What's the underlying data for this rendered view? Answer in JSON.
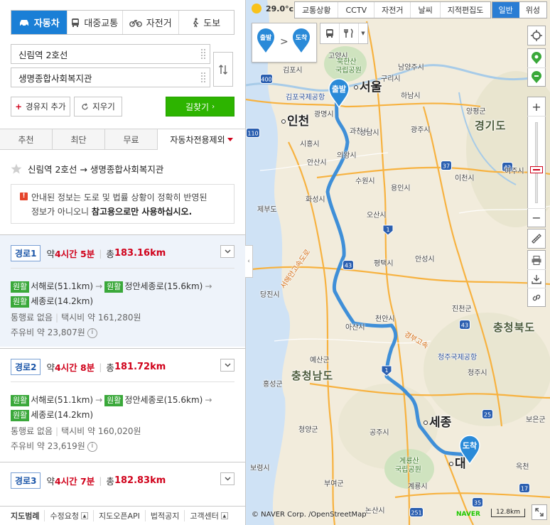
{
  "modes": [
    {
      "label": "자동차",
      "active": true
    },
    {
      "label": "대중교통",
      "active": false
    },
    {
      "label": "자전거",
      "active": false
    },
    {
      "label": "도보",
      "active": false
    }
  ],
  "origin": "신림역 2호선",
  "destination": "생명종합사회복지관",
  "buttons": {
    "waypoint": "경유지 추가",
    "clear": "지우기",
    "search": "길찾기"
  },
  "option_tabs": [
    "추천",
    "최단",
    "무료",
    "자동차전용제외"
  ],
  "route_title": "신림역 2호선 → 생명종합사회복지관",
  "notice": {
    "line1": "안내된 정보는 도로 및 법률 상황이 정확히 반영된",
    "line2_pre": "정보가 아니오니 ",
    "line2_bold": "참고용으로만 사용하십시오."
  },
  "routes": [
    {
      "tag": "경로1",
      "dur_prefix": "약 ",
      "dur_value": "4시간 5분",
      "dist_prefix": "총",
      "dist_value": "183.16km",
      "road1_badge": "원활",
      "road1": "서해로(51.1km)",
      "road2_badge": "원활",
      "road2": "정안세종로(15.6km)",
      "road3_badge": "원활",
      "road3": "세종로(14.2km)",
      "toll": "통행료 없음",
      "taxi": "택시비 약 161,280원",
      "fuel": "주유비 약 23,807원"
    },
    {
      "tag": "경로2",
      "dur_prefix": "약 ",
      "dur_value": "4시간 8분",
      "dist_prefix": "총",
      "dist_value": "181.72km",
      "road1_badge": "원활",
      "road1": "서해로(51.1km)",
      "road2_badge": "원활",
      "road2": "정안세종로(15.6km)",
      "road3_badge": "원활",
      "road3": "세종로(14.2km)",
      "toll": "통행료 없음",
      "taxi": "택시비 약 160,020원",
      "fuel": "주유비 약 23,619원"
    },
    {
      "tag": "경로3",
      "dur_prefix": "약 ",
      "dur_value": "4시간 7분",
      "dist_prefix": "총",
      "dist_value": "182.83km"
    }
  ],
  "footer": [
    "지도범례",
    "수정요청",
    "지도오픈API",
    "법적공지",
    "고객센터"
  ],
  "map": {
    "weather": "29.0°c",
    "layers": [
      "교통상황",
      "CCTV",
      "자전거",
      "날씨",
      "지적편집도"
    ],
    "map_types": [
      "일반",
      "위성"
    ],
    "od": {
      "start": "출발",
      "end": "도착"
    },
    "pin_start": "출발",
    "pin_end": "도착",
    "labels": {
      "seoul": "서울",
      "incheon": "인천",
      "gyeonggi": "경기도",
      "chungbuk": "충청북도",
      "chungnam": "충청남도",
      "sejong": "세종",
      "daejeon": "대",
      "gimpo": "김포시",
      "goyang": "고양시",
      "namyangju": "남양주시",
      "guri": "구리시",
      "hanam": "하남시",
      "bukhansan": "북한산",
      "bukhansan2": "국립공원",
      "gimpo_air": "김포국제공항",
      "gwangmyeong": "광명시",
      "gwacheon": "과천시",
      "seongnam": "성남시",
      "gwangju": "광주시",
      "yangpyeong": "양평군",
      "yeoju": "여주시",
      "icheon": "이천시",
      "siheung": "시흥시",
      "uiwang": "의왕시",
      "ansan": "안산시",
      "suwon": "수원시",
      "yongin": "용인시",
      "hwaseong": "화성시",
      "jebudo": "제부도",
      "osan": "오산시",
      "pyeongtaek": "평택시",
      "anseong": "안성시",
      "dangjin": "당진시",
      "cheonan": "천안시",
      "asan": "아산시",
      "jincheon": "진천군",
      "cheongju_air": "청주국제공항",
      "cheongju": "청주시",
      "yesan": "예산군",
      "hongseong": "홍성군",
      "cheongyang": "청양군",
      "gongju": "공주시",
      "boryeong": "보령시",
      "gyeryong": "계룡산",
      "gyeryong2": "국립공원",
      "buyeo": "부여군",
      "gyeryongsi": "계룡시",
      "nonsan": "논산시",
      "boeun": "보은군",
      "okcheon": "옥천",
      "west_coast": "서해안고속도로",
      "gyeongbu": "경부고속"
    },
    "shields": [
      "400",
      "110",
      "1",
      "43",
      "37",
      "42",
      "1",
      "43",
      "25",
      "35",
      "251",
      "17"
    ],
    "copyright": "© NAVER Corp. /OpenStreetMap",
    "naver": "NAVER",
    "scale": "12.8km"
  }
}
